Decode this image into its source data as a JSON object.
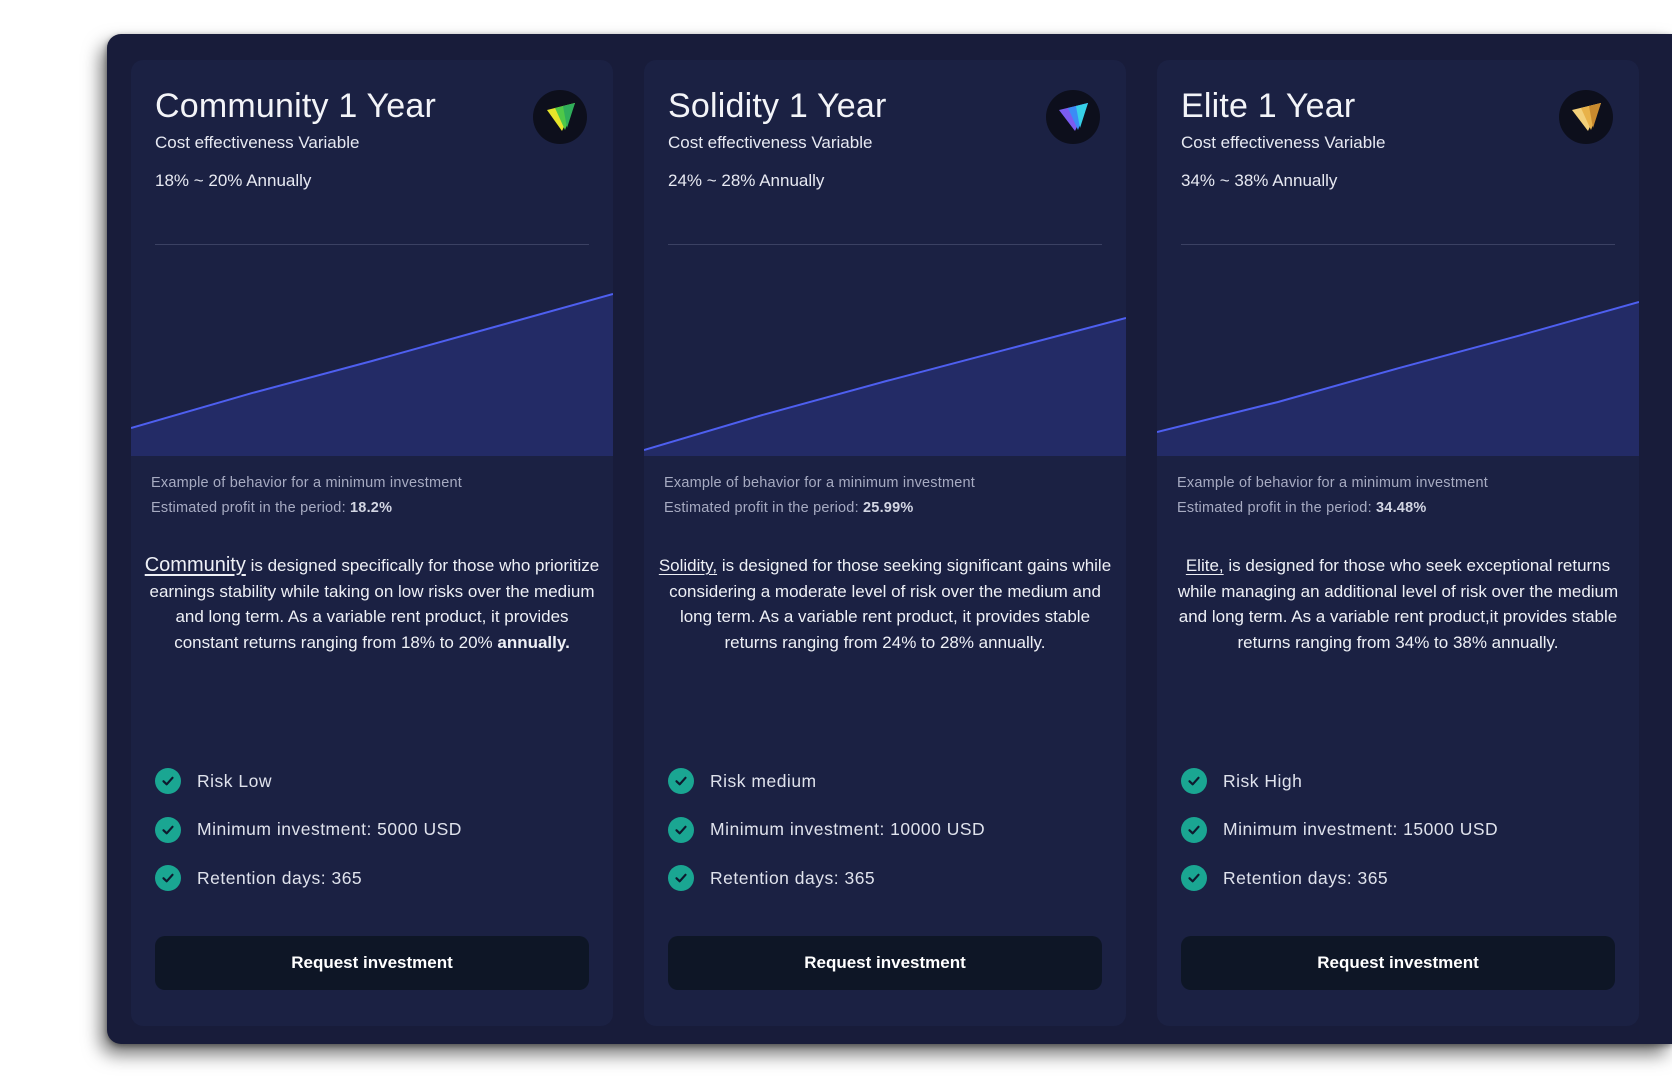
{
  "colors": {
    "frame_bg": "#181c3a",
    "card_bg": "#1b2143",
    "chart_line": "#4e5ff0",
    "chart_fill": "#232b66",
    "check": "#1aa692",
    "button_bg": "#0e1626"
  },
  "cards": [
    {
      "title": "Community 1 Year",
      "subtitle": "Cost effectiveness Variable",
      "rate": "18% ~ 20% Annually",
      "icon": "green-shield-logo-icon",
      "chart_caption_line1": "Example of behavior for a minimum investment",
      "chart_caption_label": "Estimated profit in the period:",
      "chart_caption_value": "18.2%",
      "description": {
        "brand": "Community",
        "text": "is designed specifically for those who prioritize earnings stability while taking on low risks over the medium and long term. As a variable rent product, it provides constant returns ranging from 18% to 20%",
        "ending": "annually."
      },
      "features": [
        "Risk Low",
        "Minimum investment: 5000 USD",
        "Retention days: 365"
      ],
      "button_label": "Request investment"
    },
    {
      "title": "Solidity 1 Year",
      "subtitle": "Cost effectiveness Variable",
      "rate": "24% ~ 28% Annually",
      "icon": "blue-shield-logo-icon",
      "chart_caption_line1": "Example of behavior for a minimum investment",
      "chart_caption_label": "Estimated profit in the period:",
      "chart_caption_value": "25.99%",
      "description": {
        "brand": "Solidity,",
        "text": "is designed for those seeking significant gains while considering a moderate level of risk over the medium and long term. As a variable rent product, it provides stable returns ranging from 24% to 28% annually."
      },
      "features": [
        "Risk medium",
        "Minimum investment: 10000 USD",
        "Retention days: 365"
      ],
      "button_label": "Request investment"
    },
    {
      "title": "Elite 1 Year",
      "subtitle": "Cost effectiveness Variable",
      "rate": "34% ~ 38% Annually",
      "icon": "gold-shield-logo-icon",
      "chart_caption_line1": "Example of behavior for a minimum investment",
      "chart_caption_label": "Estimated profit in the period:",
      "chart_caption_value": "34.48%",
      "description": {
        "brand": "Elite,",
        "text": "is designed for those who seek exceptional returns while managing an additional level of risk over the medium and long term. As a variable rent product,it provides stable returns ranging from 34% to 38% annually."
      },
      "features": [
        "Risk High",
        "Minimum investment: 15000 USD",
        "Retention days: 365"
      ],
      "button_label": "Request investment"
    }
  ],
  "chart_data": [
    {
      "type": "area",
      "x": [
        0,
        0.25,
        0.5,
        0.75,
        1
      ],
      "values": [
        0,
        0.26,
        0.5,
        0.75,
        1
      ]
    },
    {
      "type": "area",
      "x": [
        0,
        0.25,
        0.5,
        0.75,
        1
      ],
      "values": [
        0,
        0.27,
        0.52,
        0.76,
        1
      ]
    },
    {
      "type": "area",
      "x": [
        0,
        0.25,
        0.5,
        0.75,
        1
      ],
      "values": [
        0,
        0.23,
        0.49,
        0.74,
        1
      ]
    }
  ]
}
